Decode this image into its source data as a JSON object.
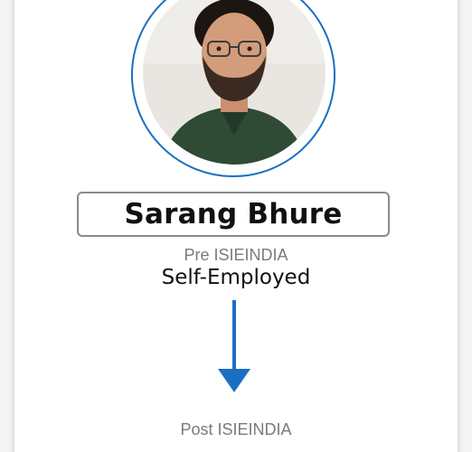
{
  "profile": {
    "name": "Sarang Bhure",
    "pre_label": "Pre ISIEINDIA",
    "pre_status": "Self-Employed",
    "post_label": "Post ISIEINDIA"
  },
  "colors": {
    "accent": "#1b6fc2",
    "name_border": "#8a8a8a",
    "muted_text": "#7a7a7a"
  },
  "icons": {
    "arrow": "arrow-down-icon",
    "avatar": "profile-photo"
  }
}
